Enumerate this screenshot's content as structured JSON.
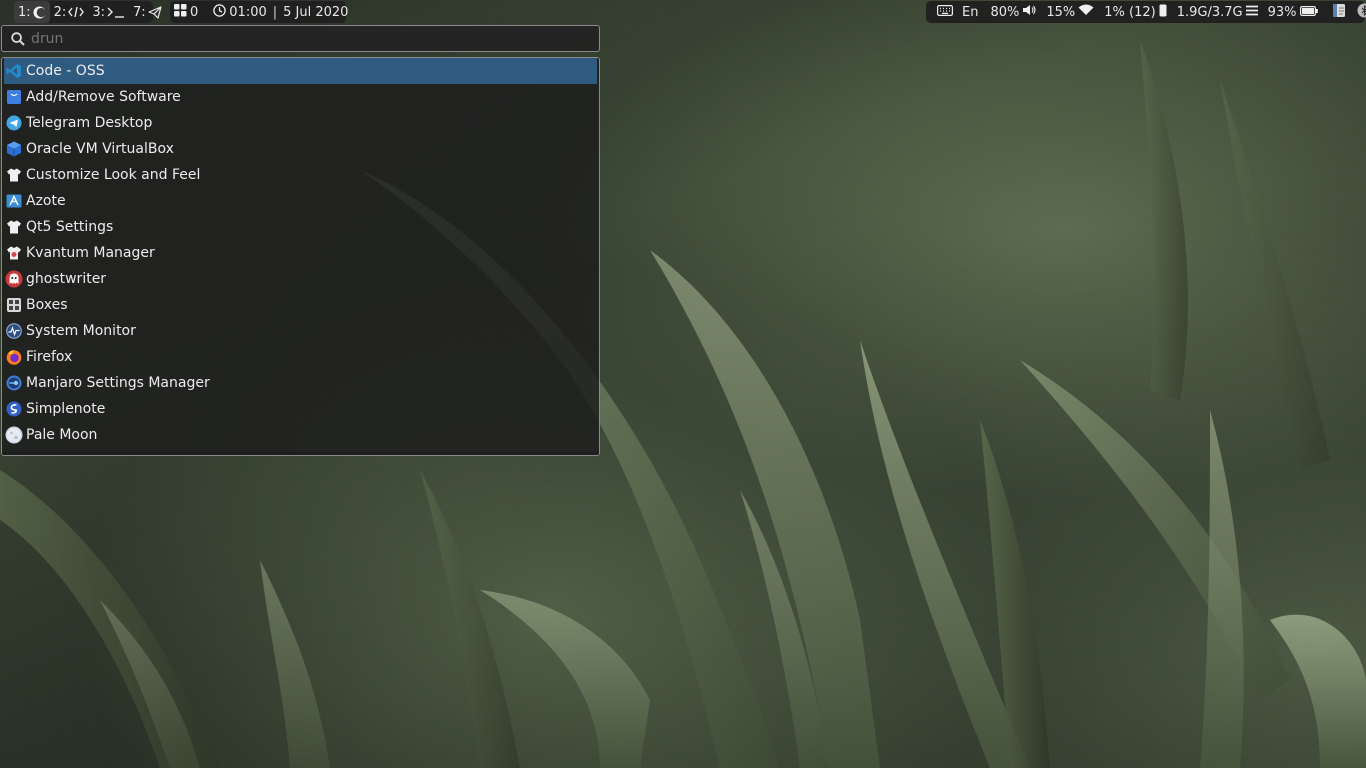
{
  "topbar": {
    "workspaces": [
      {
        "label": "1:",
        "icon": "moon-icon",
        "active": true
      },
      {
        "label": "2:",
        "icon": "code-icon",
        "active": false
      },
      {
        "label": "3:",
        "icon": "terminal-icon",
        "active": false
      },
      {
        "label": "7:",
        "icon": "telegram-icon",
        "active": false
      }
    ],
    "window_count": "0",
    "time": "01:00",
    "date": "5 Jul 2020",
    "date_separator": "|",
    "keyboard_layout": "En",
    "volume": "80%",
    "wifi_strength": "15%",
    "cpu": "1% (12)",
    "memory": "1.9G/3.7G",
    "battery": "93%"
  },
  "launcher": {
    "mode": "drun",
    "query": "",
    "entries": [
      {
        "label": "Code - OSS",
        "icon": "vscode-icon",
        "selected": true
      },
      {
        "label": "Add/Remove Software",
        "icon": "package-manager-icon"
      },
      {
        "label": "Telegram Desktop",
        "icon": "telegram-icon"
      },
      {
        "label": "Oracle VM VirtualBox",
        "icon": "virtualbox-icon"
      },
      {
        "label": "Customize Look and Feel",
        "icon": "shirt-icon"
      },
      {
        "label": "Azote",
        "icon": "azote-icon"
      },
      {
        "label": "Qt5 Settings",
        "icon": "shirt-icon"
      },
      {
        "label": "Kvantum Manager",
        "icon": "kvantum-icon"
      },
      {
        "label": "ghostwriter",
        "icon": "ghostwriter-icon"
      },
      {
        "label": "Boxes",
        "icon": "boxes-icon"
      },
      {
        "label": "System Monitor",
        "icon": "system-monitor-icon"
      },
      {
        "label": "Firefox",
        "icon": "firefox-icon"
      },
      {
        "label": "Manjaro Settings Manager",
        "icon": "manjaro-settings-icon"
      },
      {
        "label": "Simplenote",
        "icon": "simplenote-icon"
      },
      {
        "label": "Pale Moon",
        "icon": "palemoon-icon"
      }
    ]
  },
  "colors": {
    "selection": "#2f5b80",
    "panel": "#1e1e1e",
    "border": "#8a8a8a",
    "text": "#ececec"
  }
}
